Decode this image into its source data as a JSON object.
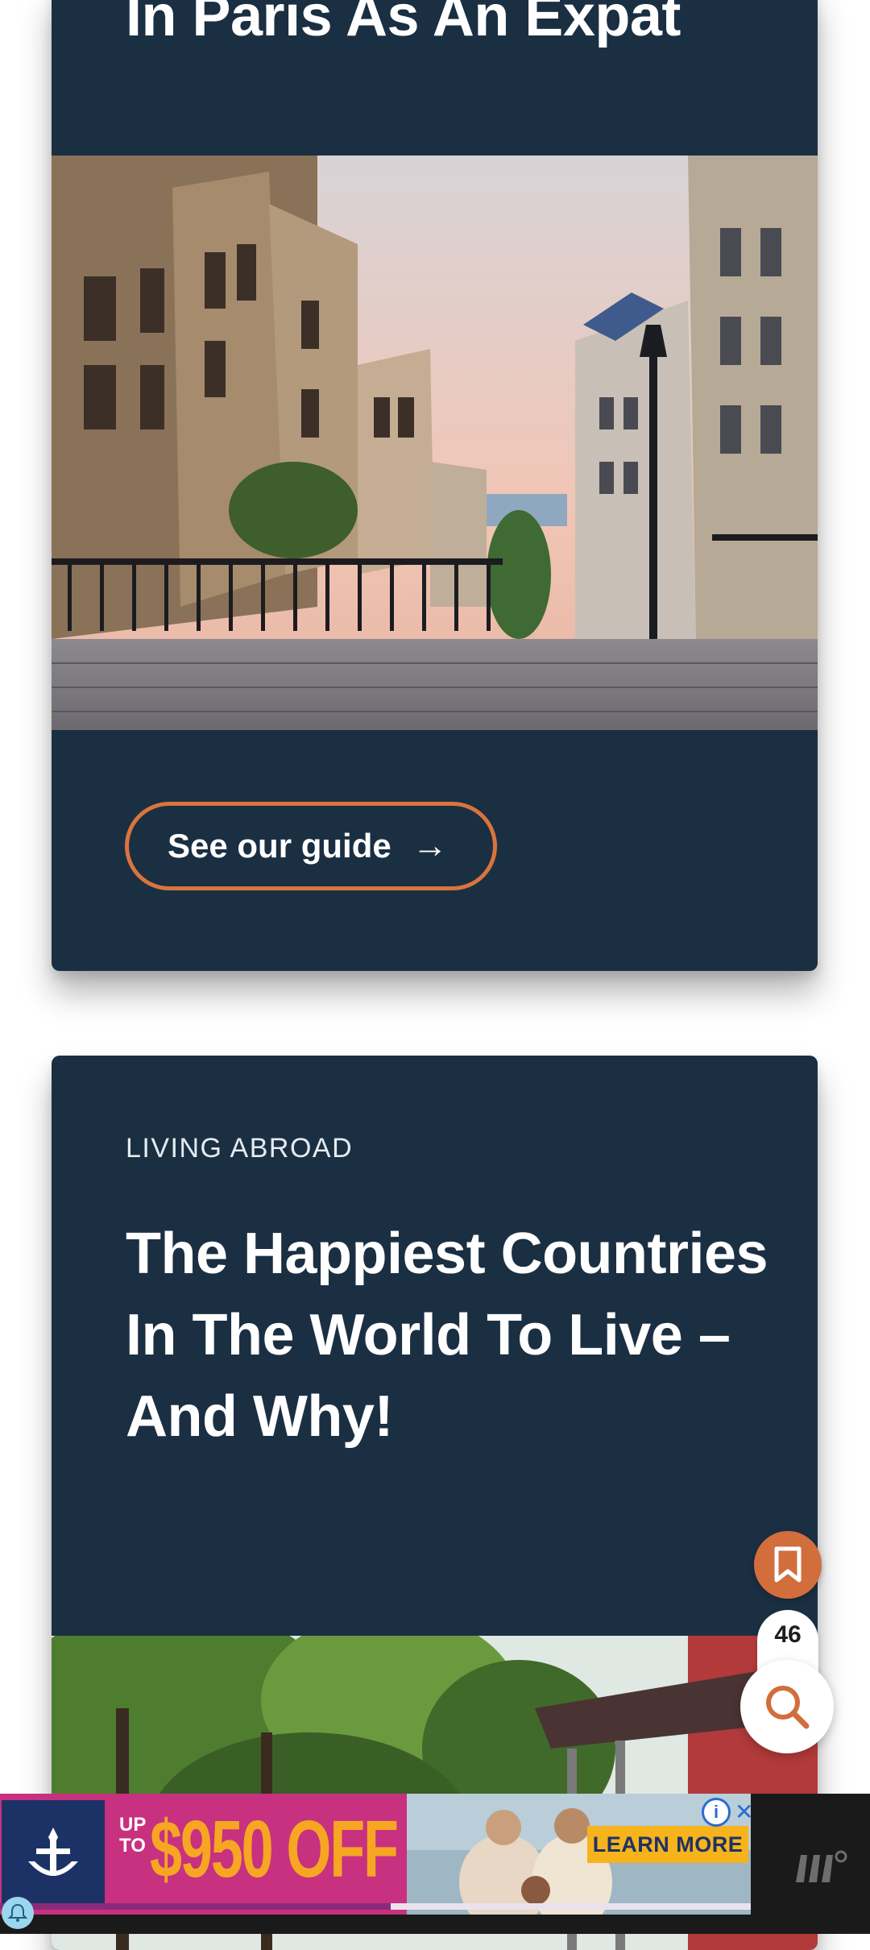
{
  "article1": {
    "title": "In Paris As An Expat",
    "button_label": "See our guide",
    "button_arrow": "→",
    "image_description": "Montmartre stairway street in Paris"
  },
  "article2": {
    "category": "LIVING ABROAD",
    "title": "The Happiest Countries In The World To Live – And Why!"
  },
  "floating": {
    "bookmark_icon": "bookmark-icon",
    "count": "46",
    "search_icon": "search-icon"
  },
  "ad": {
    "upto": "UP TO",
    "price": "$950 OFF",
    "cta": "LEARN MORE",
    "info_symbol": "i",
    "close_symbol": "✕",
    "progress": 0.52
  },
  "colors": {
    "card_bg": "#1b2f43",
    "accent": "#d9743d",
    "ad_pink": "#c7317f",
    "ad_orange": "#f6a623"
  }
}
